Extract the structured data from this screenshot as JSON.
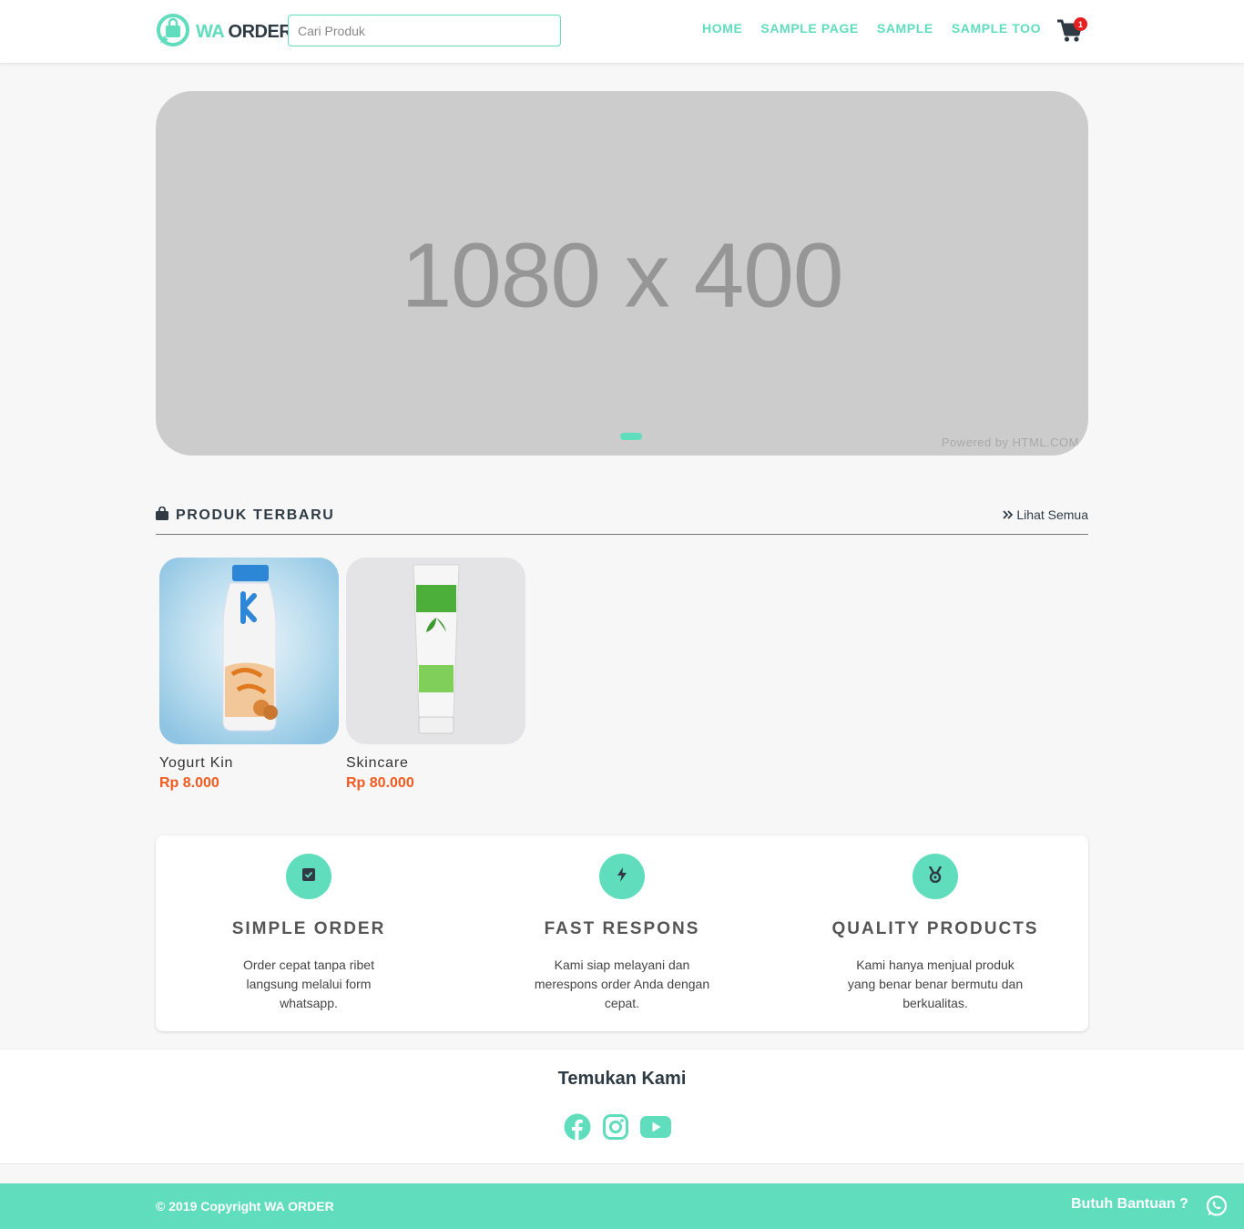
{
  "header": {
    "logo": {
      "wa": "WA",
      "order": "ORDER"
    },
    "search_placeholder": "Cari Produk",
    "nav": [
      "HOME",
      "SAMPLE PAGE",
      "SAMPLE",
      "SAMPLE TOO"
    ],
    "cart_count": "1"
  },
  "banner": {
    "text": "1080 x 400",
    "powered": "Powered by HTML.COM"
  },
  "section": {
    "title": "PRODUK TERBARU",
    "see_all": "Lihat Semua"
  },
  "products": [
    {
      "name": "Yogurt Kin",
      "price": "Rp 8.000"
    },
    {
      "name": "Skincare",
      "price": "Rp 80.000"
    }
  ],
  "features": [
    {
      "icon": "check-square-icon",
      "title": "SIMPLE ORDER",
      "desc": "Order cepat tanpa ribet langsung melalui form whatsapp."
    },
    {
      "icon": "bolt-icon",
      "title": "FAST RESPONS",
      "desc": "Kami siap melayani dan merespons order Anda dengan cepat."
    },
    {
      "icon": "medal-icon",
      "title": "QUALITY PRODUCTS",
      "desc": "Kami hanya menjual produk yang benar benar bermutu dan berkualitas."
    }
  ],
  "findus": {
    "title": "Temukan Kami",
    "socials": [
      "facebook-icon",
      "instagram-icon",
      "youtube-icon"
    ]
  },
  "footer": {
    "copyright": "© 2019 Copyright WA ORDER",
    "help": "Butuh Bantuan ?"
  },
  "colors": {
    "accent": "#5fddbd",
    "price": "#f25a1f",
    "dark": "#2f3b44",
    "badge": "#e62020"
  }
}
